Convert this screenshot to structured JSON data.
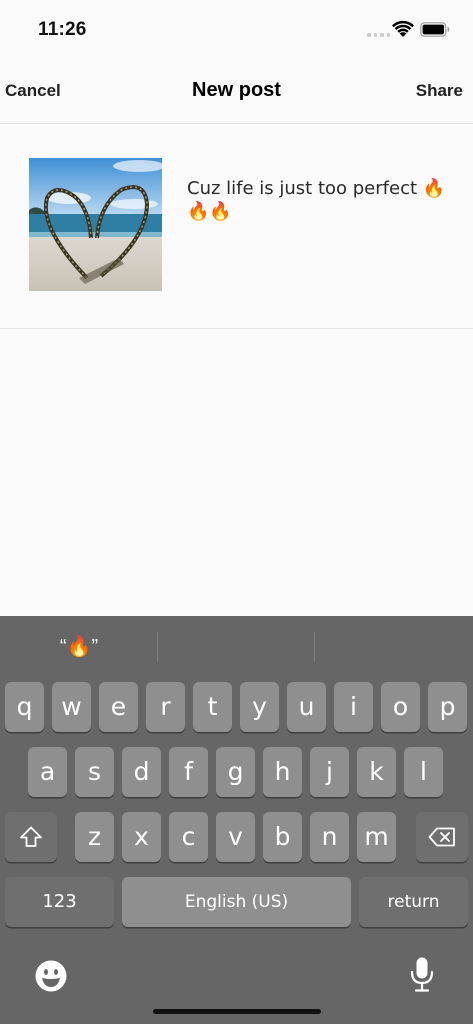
{
  "status_bar": {
    "time": "11:26",
    "icons": [
      "signal-icon",
      "wifi-icon",
      "battery-icon"
    ]
  },
  "nav": {
    "cancel_label": "Cancel",
    "title": "New post",
    "share_label": "Share"
  },
  "composer": {
    "caption": "Cuz life is just too perfect 🔥🔥🔥",
    "thumbnail_icon": "beach-heart-photo"
  },
  "keyboard": {
    "suggestions": [
      "“🔥”",
      "",
      ""
    ],
    "row1": [
      "q",
      "w",
      "e",
      "r",
      "t",
      "y",
      "u",
      "i",
      "o",
      "p"
    ],
    "row2": [
      "a",
      "s",
      "d",
      "f",
      "g",
      "h",
      "j",
      "k",
      "l"
    ],
    "row3": [
      "z",
      "x",
      "c",
      "v",
      "b",
      "n",
      "m"
    ],
    "shift_icon": "shift-icon",
    "delete_icon": "delete-icon",
    "numbers_label": "123",
    "space_label": "English (US)",
    "return_label": "return",
    "emoji_icon": "emoji-icon",
    "mic_icon": "microphone-icon"
  },
  "colors": {
    "keyboard_bg": "#666666",
    "key_bg": "#8f8f8f",
    "func_key_bg": "#6f6f6f",
    "page_bg": "#fafafa"
  }
}
